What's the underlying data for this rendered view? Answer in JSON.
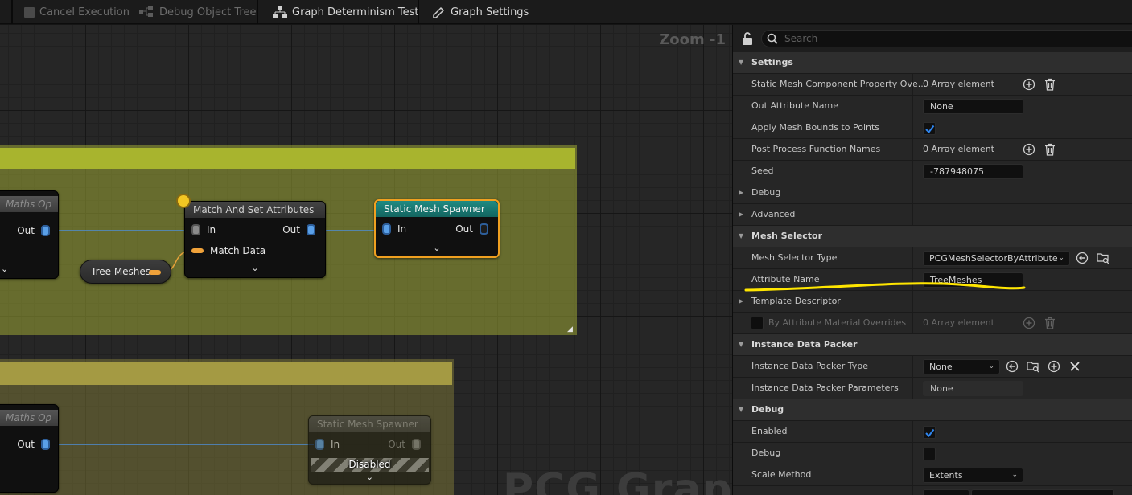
{
  "toolbar": {
    "cancel_execution": "Cancel Execution",
    "debug_object_tree": "Debug Object Tree",
    "graph_determinism_test": "Graph Determinism Test",
    "graph_settings": "Graph Settings"
  },
  "graph": {
    "zoom_label": "Zoom -1",
    "watermark": "PCG Graph",
    "nodes": {
      "maths_op_title": "Maths Op",
      "out_label": "Out",
      "in_label": "In",
      "match_title": "Match And Set Attributes",
      "match_data_label": "Match Data",
      "tree_meshes": "Tree Meshes",
      "sms_title": "Static Mesh Spawner",
      "sms2_title": "Static Mesh Spawner",
      "disabled_label": "Disabled"
    }
  },
  "details": {
    "search_placeholder": "Search",
    "settings_section": "Settings",
    "rows": {
      "smc_prop": "Static Mesh Component Property Ove...",
      "smc_prop_val": "0 Array element",
      "out_attr": "Out Attribute Name",
      "out_attr_val": "None",
      "apply_bounds": "Apply Mesh Bounds to Points",
      "post_process": "Post Process Function Names",
      "post_process_val": "0 Array element",
      "seed": "Seed",
      "seed_val": "-787948075",
      "debug": "Debug",
      "advanced": "Advanced"
    },
    "mesh_selector_section": "Mesh Selector",
    "mesh_selector": {
      "type_label": "Mesh Selector Type",
      "type_val": "PCGMeshSelectorByAttribute",
      "attr_label": "Attribute Name",
      "attr_val": "TreeMeshes",
      "template": "Template Descriptor",
      "by_attr_mat": "By Attribute Material Overrides",
      "by_attr_mat_val": "0 Array element"
    },
    "idp_section": "Instance Data Packer",
    "idp": {
      "type_label": "Instance Data Packer Type",
      "type_val": "None",
      "params_label": "Instance Data Packer Parameters",
      "params_val": "None"
    },
    "debug_section": "Debug",
    "debug": {
      "enabled": "Enabled",
      "debug": "Debug",
      "scale_method": "Scale Method",
      "scale_method_val": "Extents"
    }
  },
  "colors": {
    "accent_checkbox": "#1a6fd6",
    "selection_outline": "#f0a020",
    "annotation_underline": "#ffe600"
  }
}
